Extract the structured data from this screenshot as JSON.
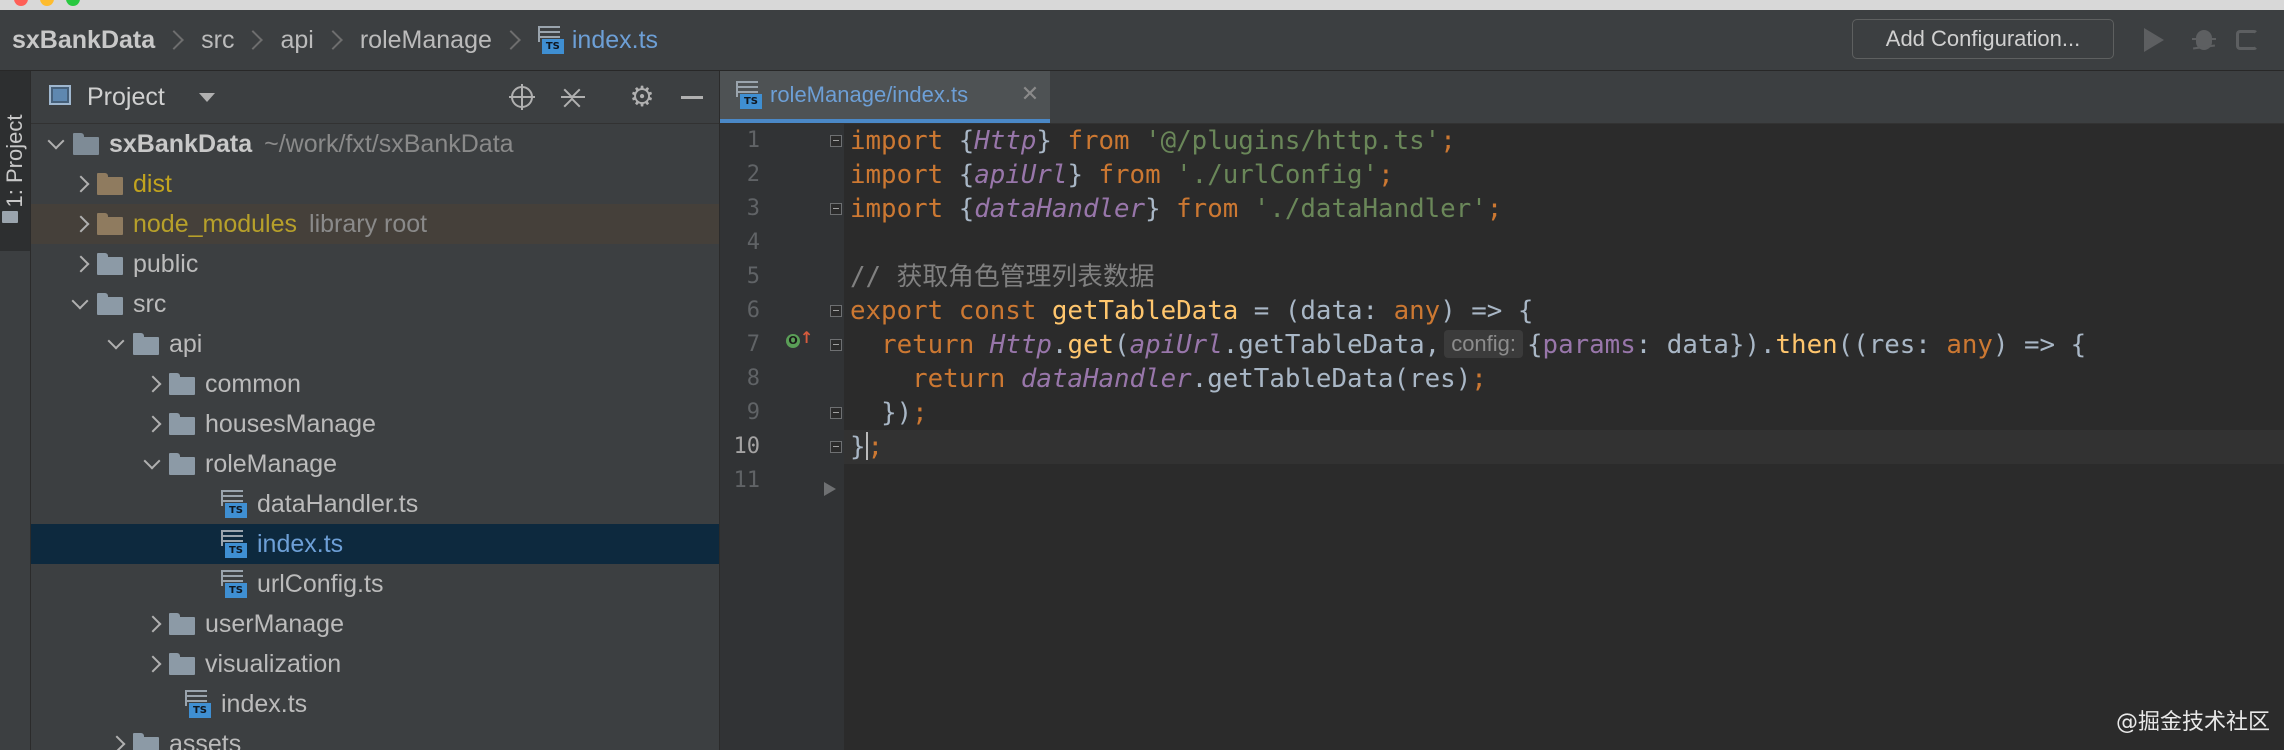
{
  "window": {
    "breadcrumb": [
      "sxBankData",
      "src",
      "api",
      "roleManage",
      "index.ts"
    ],
    "toolbar": {
      "add_configuration": "Add Configuration..."
    }
  },
  "tool_strip": {
    "project_tab": "1: Project"
  },
  "project_panel": {
    "title": "Project",
    "tree": [
      {
        "name": "sxBankData",
        "extra": "~/work/fxt/sxBankData",
        "kind": "root"
      },
      {
        "name": "dist",
        "extra": "",
        "kind": "folder"
      },
      {
        "name": "node_modules",
        "extra": "library root",
        "kind": "folder"
      },
      {
        "name": "public",
        "extra": "",
        "kind": "folder"
      },
      {
        "name": "src",
        "extra": "",
        "kind": "folder"
      },
      {
        "name": "api",
        "extra": "",
        "kind": "folder"
      },
      {
        "name": "common",
        "extra": "",
        "kind": "folder"
      },
      {
        "name": "housesManage",
        "extra": "",
        "kind": "folder"
      },
      {
        "name": "roleManage",
        "extra": "",
        "kind": "folder"
      },
      {
        "name": "dataHandler.ts",
        "extra": "",
        "kind": "file"
      },
      {
        "name": "index.ts",
        "extra": "",
        "kind": "file",
        "selected": true
      },
      {
        "name": "urlConfig.ts",
        "extra": "",
        "kind": "file"
      },
      {
        "name": "userManage",
        "extra": "",
        "kind": "folder"
      },
      {
        "name": "visualization",
        "extra": "",
        "kind": "folder"
      },
      {
        "name": "index.ts",
        "extra": "",
        "kind": "file"
      },
      {
        "name": "assets",
        "extra": "",
        "kind": "folder"
      }
    ]
  },
  "editor": {
    "active_tab": "roleManage/index.ts",
    "line_numbers": [
      "1",
      "2",
      "3",
      "4",
      "5",
      "6",
      "7",
      "8",
      "9",
      "10",
      "11"
    ],
    "current_line": "10",
    "tokens": {
      "l1": [
        "import",
        " {",
        "Http",
        "} ",
        "from",
        " ",
        "'@/plugins/http.ts'",
        ";"
      ],
      "l2": [
        "import",
        " {",
        "apiUrl",
        "} ",
        "from",
        " ",
        "'./urlConfig'",
        ";"
      ],
      "l3": [
        "import",
        " {",
        "dataHandler",
        "} ",
        "from",
        " ",
        "'./dataHandler'",
        ";"
      ],
      "l5": [
        "// 获取角色管理列表数据"
      ],
      "l6": [
        "export",
        " ",
        "const",
        " ",
        "getTableData",
        " = (data: ",
        "any",
        ") => {"
      ],
      "l7": [
        "  ",
        "return",
        " ",
        "Http",
        ".",
        "get",
        "(",
        "apiUrl",
        ".getTableData,",
        "config:",
        "{",
        "params",
        ": data}).",
        "then",
        "((res: ",
        "any",
        ") => {"
      ],
      "l8": [
        "    ",
        "return",
        " ",
        "dataHandler",
        ".getTableData(res)",
        ";"
      ],
      "l9": [
        "  ",
        "})",
        ";"
      ],
      "l10": [
        "}",
        ";"
      ]
    }
  },
  "watermark": "@掘金技术社区",
  "colors": {
    "keyword": "#cc7832",
    "string": "#6a8759",
    "class_ref": "#9876aa",
    "function": "#ffc66d",
    "comment": "#808080",
    "selection": "#0d293e",
    "accent": "#4a88c7"
  }
}
